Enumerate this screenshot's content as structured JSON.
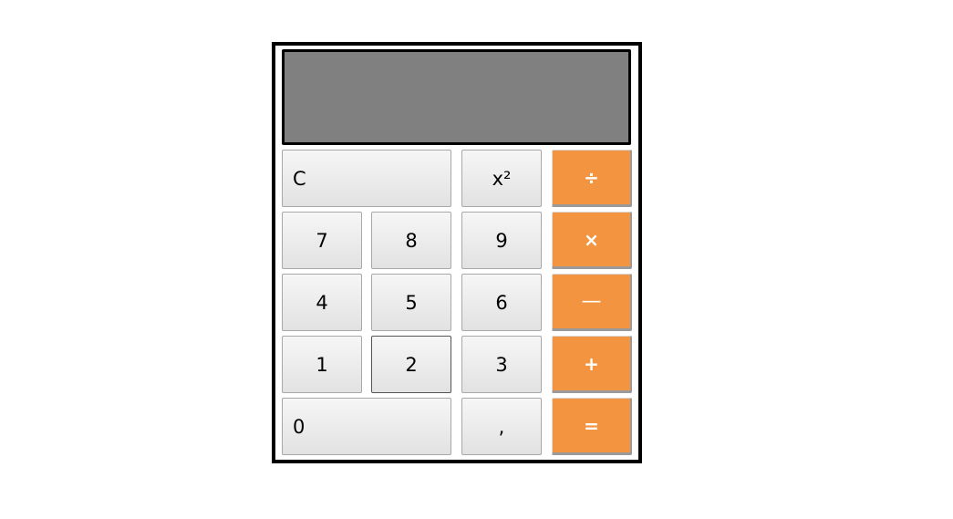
{
  "display": {
    "value": ""
  },
  "colors": {
    "display_bg": "#808080",
    "operator_bg": "#f39441",
    "key_bg": "#eeeeee",
    "frame": "#000000"
  },
  "keys": {
    "clear": "C",
    "square": "x²",
    "divide": "÷",
    "seven": "7",
    "eight": "8",
    "nine": "9",
    "multiply": "×",
    "four": "4",
    "five": "5",
    "six": "6",
    "minus": "—",
    "one": "1",
    "two": "2",
    "three": "3",
    "plus": "+",
    "zero": "0",
    "decimal": ",",
    "equals": "="
  }
}
